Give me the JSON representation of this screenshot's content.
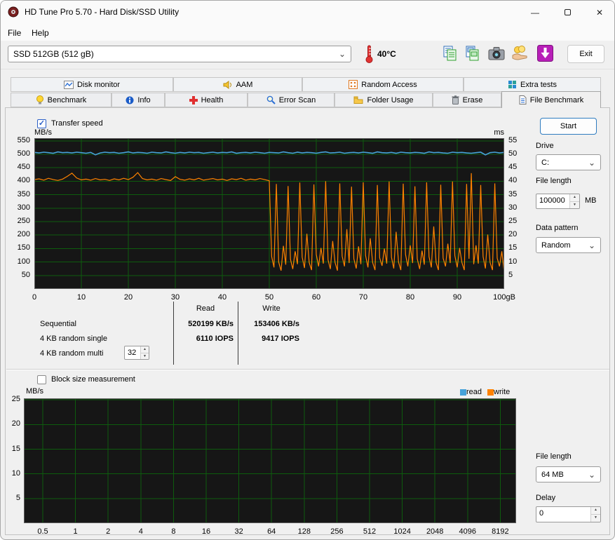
{
  "window": {
    "title": "HD Tune Pro 5.70 - Hard Disk/SSD Utility"
  },
  "icons": {
    "close": "✕",
    "minimize": "—",
    "combo_arrow": "⌄",
    "spin_up": "▲",
    "spin_down": "▼",
    "check": "✓"
  },
  "menu": {
    "file": "File",
    "help": "Help"
  },
  "toolbar": {
    "device_select": "SSD 512GB (512 gB)",
    "temperature": "40°C",
    "exit": "Exit"
  },
  "tabs": {
    "row1": [
      "Disk monitor",
      "AAM",
      "Random Access",
      "Extra tests"
    ],
    "row2": [
      "Benchmark",
      "Info",
      "Health",
      "Error Scan",
      "Folder Usage",
      "Erase",
      "File Benchmark"
    ],
    "active": "File Benchmark"
  },
  "file_benchmark": {
    "transfer_speed": "Transfer speed",
    "start": "Start",
    "drive_label": "Drive",
    "drive_value": "C:",
    "file_length_label": "File length",
    "file_length_value": "100000",
    "file_length_unit": "MB",
    "data_pattern_label": "Data pattern",
    "data_pattern_value": "Random",
    "results": {
      "read_header": "Read",
      "write_header": "Write",
      "rows": [
        {
          "label": "Sequential",
          "read": "520199 KB/s",
          "write": "153406 KB/s"
        },
        {
          "label": "4 KB random single",
          "read": "6110 IOPS",
          "write": "9417 IOPS"
        },
        {
          "label": "4 KB random multi",
          "value": "32"
        }
      ]
    },
    "block_size": "Block size measurement",
    "legend": {
      "read": "read",
      "write": "write"
    },
    "file_length2_label": "File length",
    "file_length2_value": "64 MB",
    "delay_label": "Delay",
    "delay_value": "0"
  },
  "chart_data": [
    {
      "type": "line",
      "title": "Transfer speed benchmark",
      "ylabel_left": "MB/s",
      "ylabel_right": "ms",
      "xlabel": "gB",
      "ylim_left": [
        0,
        560
      ],
      "ylim_right": [
        0,
        56
      ],
      "xlim": [
        0,
        100
      ],
      "grid": true,
      "y_ticks_left": [
        550,
        500,
        450,
        400,
        350,
        300,
        250,
        200,
        150,
        100,
        50
      ],
      "y_ticks_right": [
        55,
        50,
        45,
        40,
        35,
        30,
        25,
        20,
        15,
        10,
        5
      ],
      "x_tick_values": [
        0,
        10,
        20,
        30,
        40,
        50,
        60,
        70,
        80,
        90,
        100
      ],
      "x_tick_labels": [
        "0",
        "10",
        "20",
        "30",
        "40",
        "50",
        "60",
        "70",
        "80",
        "90",
        "100gB"
      ],
      "series": [
        {
          "name": "read",
          "color": "#46a2d9",
          "points": [
            [
              0,
              507
            ],
            [
              1,
              505
            ],
            [
              2,
              508
            ],
            [
              3,
              506
            ],
            [
              4,
              504
            ],
            [
              5,
              509
            ],
            [
              6,
              506
            ],
            [
              7,
              507
            ],
            [
              8,
              505
            ],
            [
              9,
              508
            ],
            [
              10,
              506
            ],
            [
              11,
              504
            ],
            [
              12,
              507
            ],
            [
              13,
              498
            ],
            [
              14,
              505
            ],
            [
              15,
              508
            ],
            [
              16,
              506
            ],
            [
              17,
              507
            ],
            [
              18,
              504
            ],
            [
              19,
              506
            ],
            [
              20,
              509
            ],
            [
              21,
              505
            ],
            [
              22,
              507
            ],
            [
              23,
              506
            ],
            [
              24,
              504
            ],
            [
              25,
              508
            ],
            [
              26,
              506
            ],
            [
              27,
              505
            ],
            [
              28,
              509
            ],
            [
              29,
              506
            ],
            [
              30,
              504
            ],
            [
              31,
              507
            ],
            [
              32,
              505
            ],
            [
              33,
              508
            ],
            [
              34,
              506
            ],
            [
              35,
              507
            ],
            [
              36,
              504
            ],
            [
              37,
              506
            ],
            [
              38,
              508
            ],
            [
              39,
              505
            ],
            [
              40,
              507
            ],
            [
              41,
              506
            ],
            [
              42,
              509
            ],
            [
              43,
              504
            ],
            [
              44,
              506
            ],
            [
              45,
              507
            ],
            [
              46,
              505
            ],
            [
              47,
              508
            ],
            [
              48,
              506
            ],
            [
              49,
              504
            ],
            [
              50,
              507
            ],
            [
              51,
              506
            ],
            [
              52,
              505
            ],
            [
              53,
              509
            ],
            [
              54,
              506
            ],
            [
              55,
              504
            ],
            [
              56,
              508
            ],
            [
              57,
              505
            ],
            [
              58,
              507
            ],
            [
              59,
              506
            ],
            [
              60,
              504
            ],
            [
              61,
              507
            ],
            [
              62,
              509
            ],
            [
              63,
              505
            ],
            [
              64,
              506
            ],
            [
              65,
              508
            ],
            [
              66,
              504
            ],
            [
              67,
              506
            ],
            [
              68,
              507
            ],
            [
              69,
              505
            ],
            [
              70,
              508
            ],
            [
              71,
              506
            ],
            [
              72,
              504
            ],
            [
              73,
              509
            ],
            [
              74,
              506
            ],
            [
              75,
              505
            ],
            [
              76,
              507
            ],
            [
              77,
              504
            ],
            [
              78,
              508
            ],
            [
              79,
              506
            ],
            [
              80,
              505
            ],
            [
              81,
              507
            ],
            [
              82,
              506
            ],
            [
              83,
              504
            ],
            [
              84,
              509
            ],
            [
              85,
              506
            ],
            [
              86,
              507
            ],
            [
              87,
              505
            ],
            [
              88,
              504
            ],
            [
              89,
              508
            ],
            [
              90,
              506
            ],
            [
              91,
              507
            ],
            [
              92,
              505
            ],
            [
              93,
              504
            ],
            [
              94,
              506
            ],
            [
              95,
              508
            ],
            [
              96,
              498
            ],
            [
              97,
              506
            ],
            [
              98,
              508
            ],
            [
              99,
              505
            ],
            [
              100,
              507
            ]
          ]
        },
        {
          "name": "write",
          "color": "#ff8200",
          "points": [
            [
              0,
              406
            ],
            [
              1,
              409
            ],
            [
              2,
              404
            ],
            [
              3,
              411
            ],
            [
              4,
              406
            ],
            [
              5,
              403
            ],
            [
              6,
              408
            ],
            [
              7,
              418
            ],
            [
              8,
              430
            ],
            [
              9,
              412
            ],
            [
              10,
              405
            ],
            [
              11,
              408
            ],
            [
              12,
              404
            ],
            [
              13,
              410
            ],
            [
              14,
              405
            ],
            [
              15,
              407
            ],
            [
              16,
              403
            ],
            [
              17,
              409
            ],
            [
              18,
              405
            ],
            [
              19,
              411
            ],
            [
              20,
              406
            ],
            [
              21,
              415
            ],
            [
              22,
              432
            ],
            [
              23,
              410
            ],
            [
              24,
              405
            ],
            [
              25,
              408
            ],
            [
              26,
              404
            ],
            [
              27,
              410
            ],
            [
              28,
              406
            ],
            [
              29,
              403
            ],
            [
              30,
              417
            ],
            [
              31,
              407
            ],
            [
              32,
              404
            ],
            [
              33,
              409
            ],
            [
              34,
              405
            ],
            [
              35,
              411
            ],
            [
              36,
              404
            ],
            [
              37,
              407
            ],
            [
              38,
              410
            ],
            [
              39,
              405
            ],
            [
              40,
              408
            ],
            [
              41,
              403
            ],
            [
              42,
              409
            ],
            [
              43,
              406
            ],
            [
              44,
              411
            ],
            [
              45,
              404
            ],
            [
              46,
              408
            ],
            [
              47,
              405
            ],
            [
              48,
              410
            ],
            [
              49,
              406
            ],
            [
              50,
              402
            ],
            [
              50.5,
              120
            ],
            [
              51,
              80
            ],
            [
              51.5,
              390
            ],
            [
              52,
              100
            ],
            [
              52.5,
              68
            ],
            [
              53,
              160
            ],
            [
              53.5,
              90
            ],
            [
              54,
              382
            ],
            [
              54.5,
              110
            ],
            [
              55,
              74
            ],
            [
              55.5,
              140
            ],
            [
              56,
              92
            ],
            [
              56.5,
              395
            ],
            [
              57,
              118
            ],
            [
              57.5,
              78
            ],
            [
              58,
              205
            ],
            [
              58.5,
              98
            ],
            [
              59,
              70
            ],
            [
              59.5,
              388
            ],
            [
              60,
              128
            ],
            [
              60.5,
              84
            ],
            [
              61,
              152
            ],
            [
              61.5,
              94
            ],
            [
              62,
              400
            ],
            [
              62.5,
              108
            ],
            [
              63,
              74
            ],
            [
              63.5,
              178
            ],
            [
              64,
              98
            ],
            [
              64.5,
              68
            ],
            [
              65,
              392
            ],
            [
              65.5,
              122
            ],
            [
              66,
              84
            ],
            [
              66.5,
              222
            ],
            [
              67,
              96
            ],
            [
              67.5,
              380
            ],
            [
              68,
              112
            ],
            [
              68.5,
              76
            ],
            [
              69,
              158
            ],
            [
              69.5,
              92
            ],
            [
              70,
              396
            ],
            [
              70.5,
              124
            ],
            [
              71,
              80
            ],
            [
              71.5,
              188
            ],
            [
              72,
              98
            ],
            [
              72.5,
              70
            ],
            [
              73,
              386
            ],
            [
              73.5,
              116
            ],
            [
              74,
              86
            ],
            [
              74.5,
              150
            ],
            [
              75,
              94
            ],
            [
              75.5,
              399
            ],
            [
              76,
              118
            ],
            [
              76.5,
              76
            ],
            [
              77,
              212
            ],
            [
              77.5,
              100
            ],
            [
              78,
              70
            ],
            [
              78.5,
              391
            ],
            [
              79,
              128
            ],
            [
              79.5,
              84
            ],
            [
              80,
              162
            ],
            [
              80.5,
              96
            ],
            [
              81,
              381
            ],
            [
              81.5,
              112
            ],
            [
              82,
              74
            ],
            [
              82.5,
              142
            ],
            [
              83,
              90
            ],
            [
              83.5,
              396
            ],
            [
              84,
              120
            ],
            [
              84.5,
              80
            ],
            [
              85,
              232
            ],
            [
              85.5,
              98
            ],
            [
              86,
              70
            ],
            [
              86.5,
              387
            ],
            [
              87,
              114
            ],
            [
              87.5,
              84
            ],
            [
              88,
              168
            ],
            [
              88.5,
              96
            ],
            [
              89,
              399
            ],
            [
              89.5,
              124
            ],
            [
              90,
              80
            ],
            [
              90.5,
              152
            ],
            [
              91,
              98
            ],
            [
              91.5,
              70
            ],
            [
              92,
              390
            ],
            [
              92.5,
              112
            ],
            [
              93,
              430
            ],
            [
              93.5,
              92
            ],
            [
              94,
              162
            ],
            [
              94.5,
              94
            ],
            [
              95,
              386
            ],
            [
              95.5,
              120
            ],
            [
              96,
              76
            ],
            [
              96.5,
              202
            ],
            [
              97,
              98
            ],
            [
              97.5,
              70
            ],
            [
              98,
              392
            ],
            [
              98.5,
              114
            ],
            [
              99,
              84
            ],
            [
              99.5,
              140
            ],
            [
              100,
              62
            ]
          ]
        }
      ]
    },
    {
      "type": "line",
      "title": "Block size measurement",
      "ylabel": "MB/s",
      "ylim": [
        0,
        25.3
      ],
      "grid": true,
      "y_ticks": [
        25,
        20,
        15,
        10,
        5
      ],
      "x_tick_labels": [
        "0.5",
        "1",
        "2",
        "4",
        "8",
        "16",
        "32",
        "64",
        "128",
        "256",
        "512",
        "1024",
        "2048",
        "4096",
        "8192"
      ],
      "series": []
    }
  ]
}
